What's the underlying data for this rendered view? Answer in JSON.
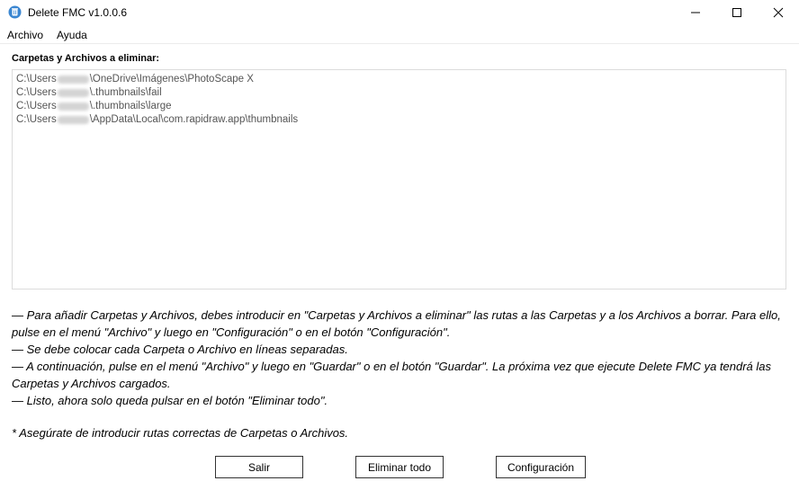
{
  "window": {
    "title": "Delete FMC v1.0.0.6",
    "icon": "app-icon",
    "controls": [
      "minimize-icon",
      "maximize-icon",
      "close-icon"
    ]
  },
  "menu": {
    "items": [
      "Archivo",
      "Ayuda"
    ]
  },
  "paths_section": {
    "label": "Carpetas y Archivos a eliminar:",
    "lines": [
      {
        "prefix": "C:\\Users",
        "suffix": "\\OneDrive\\Imágenes\\PhotoScape X"
      },
      {
        "prefix": "C:\\Users",
        "suffix": "\\.thumbnails\\fail"
      },
      {
        "prefix": "C:\\Users",
        "suffix": "\\.thumbnails\\large"
      },
      {
        "prefix": "C:\\Users",
        "suffix": "\\AppData\\Local\\com.rapidraw.app\\thumbnails"
      }
    ]
  },
  "instructions": {
    "lines": [
      "— Para añadir Carpetas y Archivos, debes introducir en \"Carpetas y Archivos a eliminar\" las rutas a las Carpetas y a los Archivos a borrar. Para ello, pulse en el menú \"Archivo\" y luego en \"Configuración\" o en el botón \"Configuración\".",
      "— Se debe colocar cada Carpeta o Archivo en líneas separadas.",
      "— A continuación, pulse en el menú \"Archivo\" y luego en \"Guardar\" o en el botón \"Guardar\". La próxima vez que ejecute Delete FMC ya tendrá las Carpetas y Archivos cargados.",
      "— Listo, ahora solo queda pulsar en el botón \"Eliminar todo\"."
    ],
    "note": "* Asegúrate de introducir rutas correctas de Carpetas o Archivos."
  },
  "buttons": {
    "salir": "Salir",
    "eliminar": "Eliminar todo",
    "config": "Configuración"
  }
}
